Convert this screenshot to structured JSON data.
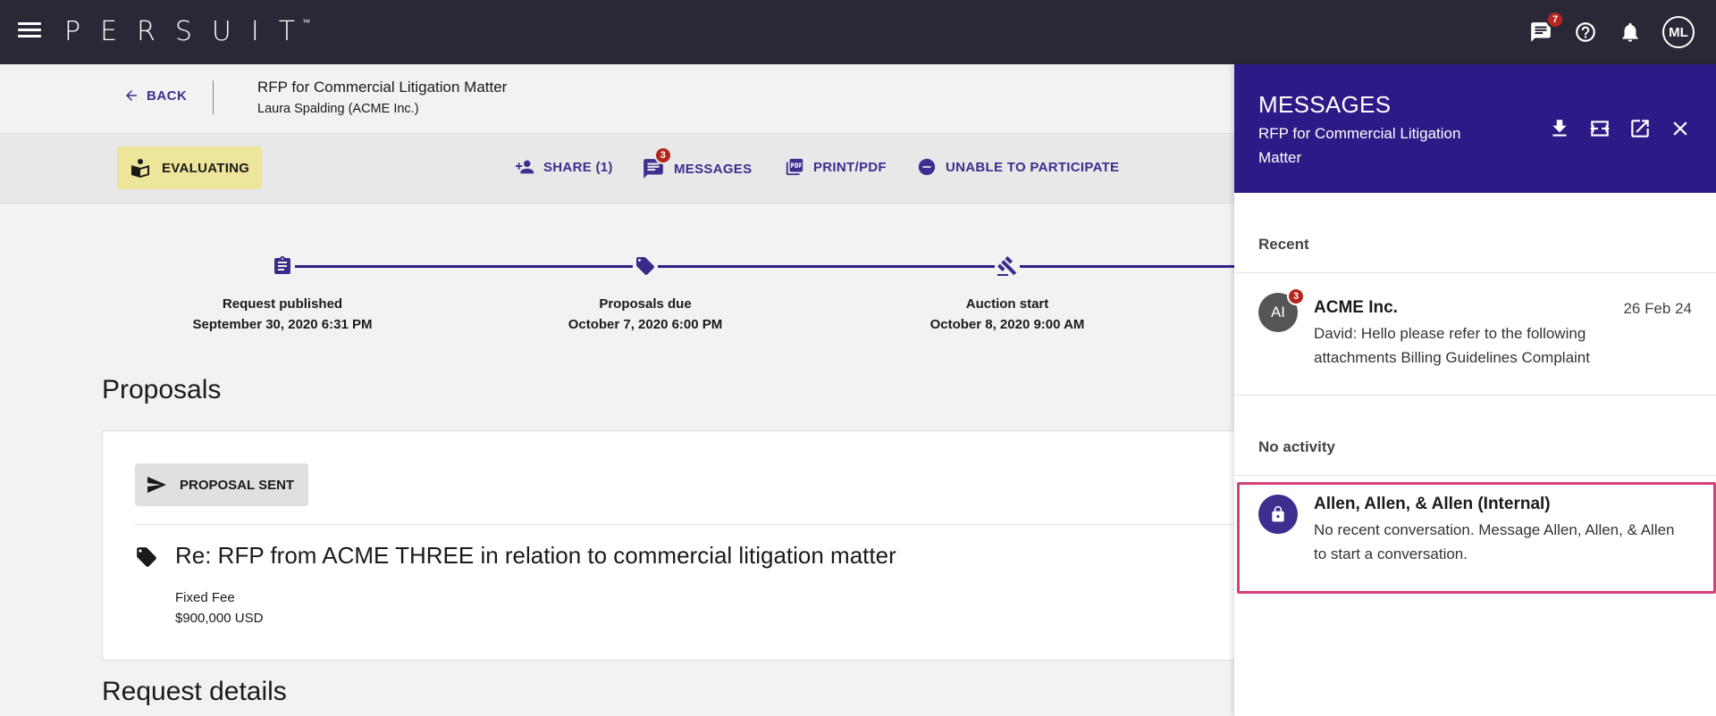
{
  "app": {
    "logo": "PERSUIT",
    "trademark": "™",
    "icons": [
      "menu-icon",
      "chat-icon",
      "help-icon",
      "bell-icon"
    ],
    "chat_badge": "7",
    "user_initials": "ML",
    "accent": "#2e1a86"
  },
  "header": {
    "back_label": "BACK",
    "title": "RFP for Commercial Litigation Matter",
    "subtitle": "Laura Spalding (ACME Inc.)"
  },
  "actions": {
    "status": "EVALUATING",
    "share": "SHARE (1)",
    "messages": "MESSAGES",
    "messages_badge": "3",
    "print": "PRINT/PDF",
    "unable": "UNABLE TO PARTICIPATE"
  },
  "timeline": [
    {
      "label": "Request published",
      "date": "September 30, 2020 6:31 PM",
      "icon": "clipboard-icon"
    },
    {
      "label": "Proposals due",
      "date": "October 7, 2020 6:00 PM",
      "icon": "tag-icon"
    },
    {
      "label": "Auction start",
      "date": "October 8, 2020 9:00 AM",
      "icon": "gavel-icon"
    }
  ],
  "proposals": {
    "heading": "Proposals",
    "status_chip": "PROPOSAL SENT",
    "title": "Re: RFP from ACME THREE in relation to commercial litigation matter",
    "fee_type": "Fixed Fee",
    "fee_value": "$900,000 USD"
  },
  "request_details_heading": "Request details",
  "messages_panel": {
    "title": "MESSAGES",
    "subtitle": "RFP for Commercial Litigation Matter",
    "header_icons": [
      "download-icon",
      "expand-icon",
      "open-external-icon",
      "close-icon"
    ],
    "recent_label": "Recent",
    "recent": {
      "initials": "AI",
      "badge": "3",
      "name": "ACME Inc.",
      "date": "26 Feb 24",
      "preview": "David: Hello please refer to the following attachments Billing Guidelines   Complaint"
    },
    "no_activity_label": "No activity",
    "inactive": {
      "name": "Allen, Allen, & Allen (Internal)",
      "preview": "No recent conversation. Message Allen, Allen, & Allen to start a conversation."
    }
  }
}
